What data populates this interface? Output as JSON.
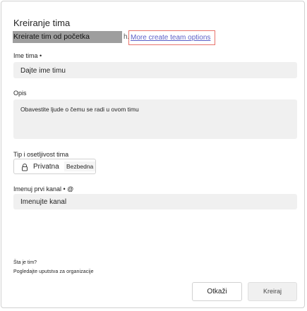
{
  "dialog": {
    "title": "Kreiranje tima",
    "subtitle": "Kreirate tim od početka",
    "subtitle_suffix": "h.",
    "more_options_link": "More create team options"
  },
  "fields": {
    "team_name": {
      "label": "Ime tima •",
      "placeholder": "Dajte ime timu"
    },
    "description": {
      "label": "Opis",
      "placeholder": "Obavestite ljude o čemu se radi u ovom timu"
    },
    "type_sensitivity": {
      "label": "Tip i osetljivost tima",
      "privacy": "Privatna",
      "sensitivity": "Bezbedna"
    },
    "first_channel": {
      "label": "Imenuj prvi kanal • @",
      "placeholder": "Imenujte kanal"
    }
  },
  "help": {
    "question": "Šta je tim?",
    "guidelines": "Pogledajte uputstva za organizacije"
  },
  "buttons": {
    "cancel": "Otkaži",
    "create": "Kreiraj"
  },
  "colors": {
    "link": "#5b5fc7",
    "link_highlight_border": "#e8736b",
    "field_bg": "#f0f0f0"
  },
  "icons": {
    "privacy": "lock-icon"
  }
}
